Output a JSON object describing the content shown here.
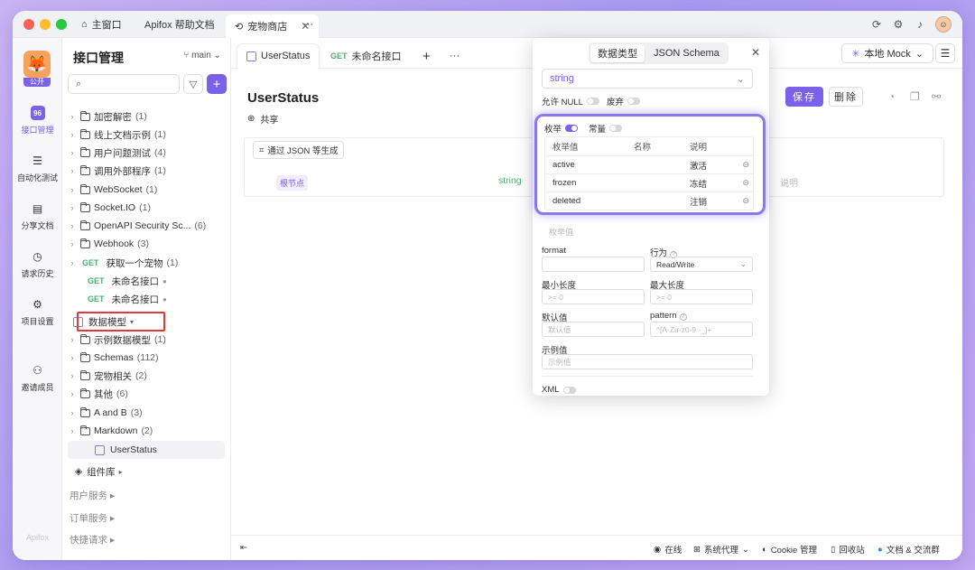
{
  "titlebar": {
    "tabs": [
      {
        "label": "主窗口",
        "icon": "home-icon"
      },
      {
        "label": "Apifox 帮助文档"
      },
      {
        "label": "宠物商店",
        "icon": "link-icon",
        "close": "✕"
      }
    ],
    "more": "···"
  },
  "rail": {
    "logo_tag": "公开",
    "items": [
      {
        "label": "接口管理",
        "icon_text": "96"
      },
      {
        "label": "自动化测试"
      },
      {
        "label": "分享文档"
      },
      {
        "label": "请求历史"
      },
      {
        "label": "项目设置"
      },
      {
        "label": "邀请成员"
      }
    ],
    "footer": "Apifox"
  },
  "tree": {
    "title": "接口管理",
    "branch": "main",
    "folders": [
      {
        "label": "加密解密",
        "count": "(1)"
      },
      {
        "label": "线上文档示例",
        "count": "(1)"
      },
      {
        "label": "用户问题测试",
        "count": "(4)"
      },
      {
        "label": "调用外部程序",
        "count": "(1)"
      },
      {
        "label": "WebSocket",
        "count": "(1)"
      },
      {
        "label": "Socket.IO",
        "count": "(1)"
      },
      {
        "label": "OpenAPI Security Sc...",
        "count": "(6)"
      },
      {
        "label": "Webhook",
        "count": "(3)"
      }
    ],
    "get_items": [
      {
        "method": "GET",
        "label": "获取一个宠物",
        "count": "(1)"
      },
      {
        "method": "GET",
        "label": "未命名接口",
        "dot": "●"
      },
      {
        "method": "GET",
        "label": "未命名接口",
        "dot": "●"
      }
    ],
    "data_model_label": "数据模型",
    "model_folders": [
      {
        "label": "示例数据模型",
        "count": "(1)"
      },
      {
        "label": "Schemas",
        "count": "(112)"
      },
      {
        "label": "宠物相关",
        "count": "(2)"
      },
      {
        "label": "其他",
        "count": "(6)"
      },
      {
        "label": "A and B",
        "count": "(3)"
      },
      {
        "label": "Markdown",
        "count": "(2)"
      }
    ],
    "selected_model": "UserStatus",
    "components": "组件库",
    "groups": [
      "用户服务",
      "订单服务",
      "快捷请求"
    ]
  },
  "main": {
    "tabs": [
      {
        "label": "UserStatus"
      },
      {
        "method": "GET",
        "label": "未命名接口"
      }
    ],
    "env": "本地 Mock",
    "title": "UserStatus",
    "share": "共享",
    "save": "保存",
    "delete": "删除",
    "generate": "通过 JSON 等生成",
    "root_badge": "根节点",
    "type_text": "string",
    "desc_placeholder": "说明"
  },
  "status": {
    "online": "在线",
    "proxy": "系统代理",
    "cookie": "Cookie 管理",
    "trash": "回收站",
    "docs": "文档 & 交流群"
  },
  "popup": {
    "tabs": [
      "数据类型",
      "JSON Schema"
    ],
    "type": "string",
    "allow_null": "允许 NULL",
    "deprecated": "废弃",
    "enum_label": "枚举",
    "const_label": "常量",
    "enum_headers": [
      "枚举值",
      "名称",
      "说明"
    ],
    "enum_rows": [
      {
        "value": "active",
        "name": "",
        "desc": "激活"
      },
      {
        "value": "frozen",
        "name": "",
        "desc": "冻结"
      },
      {
        "value": "deleted",
        "name": "",
        "desc": "注销"
      }
    ],
    "enum_placeholder": "枚举值",
    "format_label": "format",
    "behavior_label": "行为",
    "behavior_value": "Read/Write",
    "min_len_label": "最小长度",
    "max_len_label": "最大长度",
    "min_len_ph": ">= 0",
    "max_len_ph": ">= 0",
    "default_label": "默认值",
    "default_ph": "默认值",
    "pattern_label": "pattern",
    "pattern_ph": "^[A-Za-z0-9 -_]+",
    "example_label": "示例值",
    "example_ph": "示例值",
    "xml_label": "XML"
  },
  "colors": {
    "accent": "#7b61e8",
    "get": "#4caf72",
    "highlight": "#e03a3a"
  }
}
